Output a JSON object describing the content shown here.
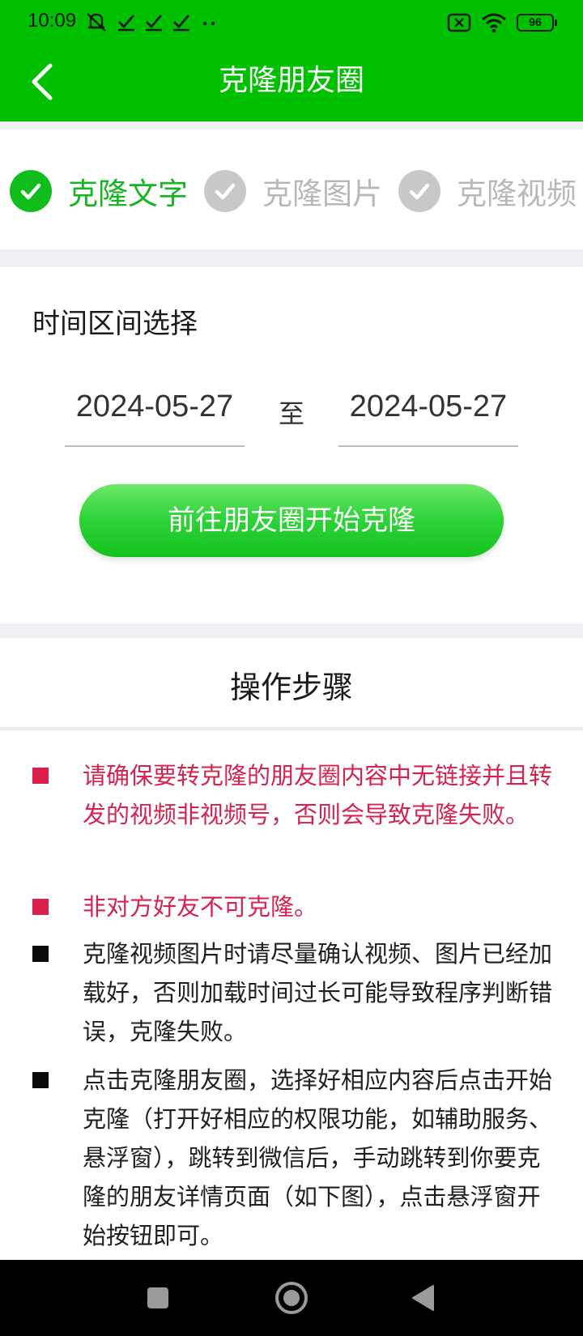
{
  "status_bar": {
    "time": "10:09",
    "battery": "96",
    "left_icons": [
      "mute-icon",
      "check-icon",
      "check-icon",
      "check-icon",
      "more-dots-icon"
    ],
    "right_icons": [
      "sim-off-icon",
      "wifi-icon",
      "battery-icon"
    ]
  },
  "header": {
    "title": "克隆朋友圈",
    "back_icon": "chevron-left-icon",
    "color": "#00c000"
  },
  "steps": [
    {
      "label": "克隆文字",
      "active": true
    },
    {
      "label": "克隆图片",
      "active": false
    },
    {
      "label": "克隆视频",
      "active": false
    }
  ],
  "range": {
    "label": "时间区间选择",
    "start_date": "2024-05-27",
    "separator": "至",
    "end_date": "2024-05-27",
    "button_label": "前往朋友圈开始克隆"
  },
  "instructions": {
    "title": "操作步骤",
    "items": [
      {
        "text": "请确保要转克隆的朋友圈内容中无链接并且转发的视频非视频号，否则会导致克隆失败。",
        "color": "#d4234e"
      },
      {
        "text": "非对方好友不可克隆。",
        "color": "#d4234e"
      },
      {
        "text": "克隆视频图片时请尽量确认视频、图片已经加载好，否则加载时间过长可能导致程序判断错误，克隆失败。",
        "color": "#1f1f1f"
      },
      {
        "text": "点击克隆朋友圈，选择好相应内容后点击开始克隆（打开好相应的权限功能，如辅助服务、悬浮窗），跳转到微信后，手动跳转到你要克隆的朋友详情页面（如下图），点击悬浮窗开始按钮即可。",
        "color": "#1f1f1f"
      }
    ]
  },
  "nav_bar": {
    "buttons": [
      "recents-square-icon",
      "home-circle-icon",
      "back-triangle-icon"
    ]
  }
}
